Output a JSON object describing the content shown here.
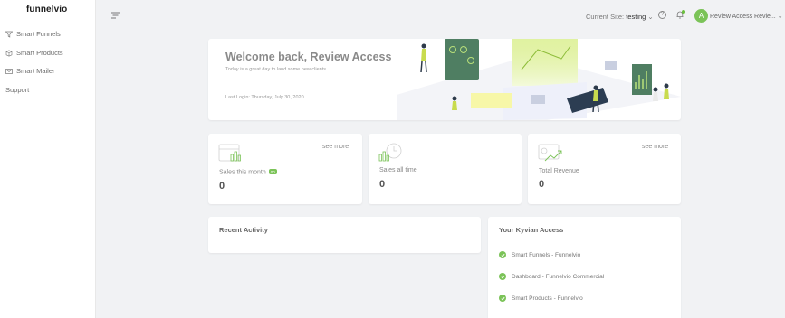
{
  "brand": {
    "logo_text": "funnelvio",
    "accent": "#7bc358"
  },
  "sidebar": {
    "items": [
      {
        "label": "Smart Funnels",
        "icon": "funnel-icon"
      },
      {
        "label": "Smart Products",
        "icon": "box-icon"
      },
      {
        "label": "Smart Mailer",
        "icon": "mail-icon"
      },
      {
        "label": "Support",
        "icon": ""
      }
    ]
  },
  "topbar": {
    "current_site_label": "Current Site:",
    "current_site_value": "testing",
    "user_initial": "A",
    "user_name": "Review Access Revie..."
  },
  "welcome": {
    "title": "Welcome back, Review Access",
    "subtitle": "Today is a great day to land some new clients.",
    "last_login": "Last Login: Thursday, July 30, 2020"
  },
  "stats": [
    {
      "label": "Sales this month",
      "value": "0",
      "see_more": "see more",
      "badge": "00"
    },
    {
      "label": "Sales all time",
      "value": "0"
    },
    {
      "label": "Total Revenue",
      "value": "0",
      "see_more": "see more"
    }
  ],
  "recent_activity": {
    "title": "Recent Activity"
  },
  "access": {
    "title": "Your Kyvian Access",
    "items": [
      "Smart Funnels - Funnelvio",
      "Dashboard - Funnelvio Commercial",
      "Smart Products - Funnelvio"
    ]
  }
}
